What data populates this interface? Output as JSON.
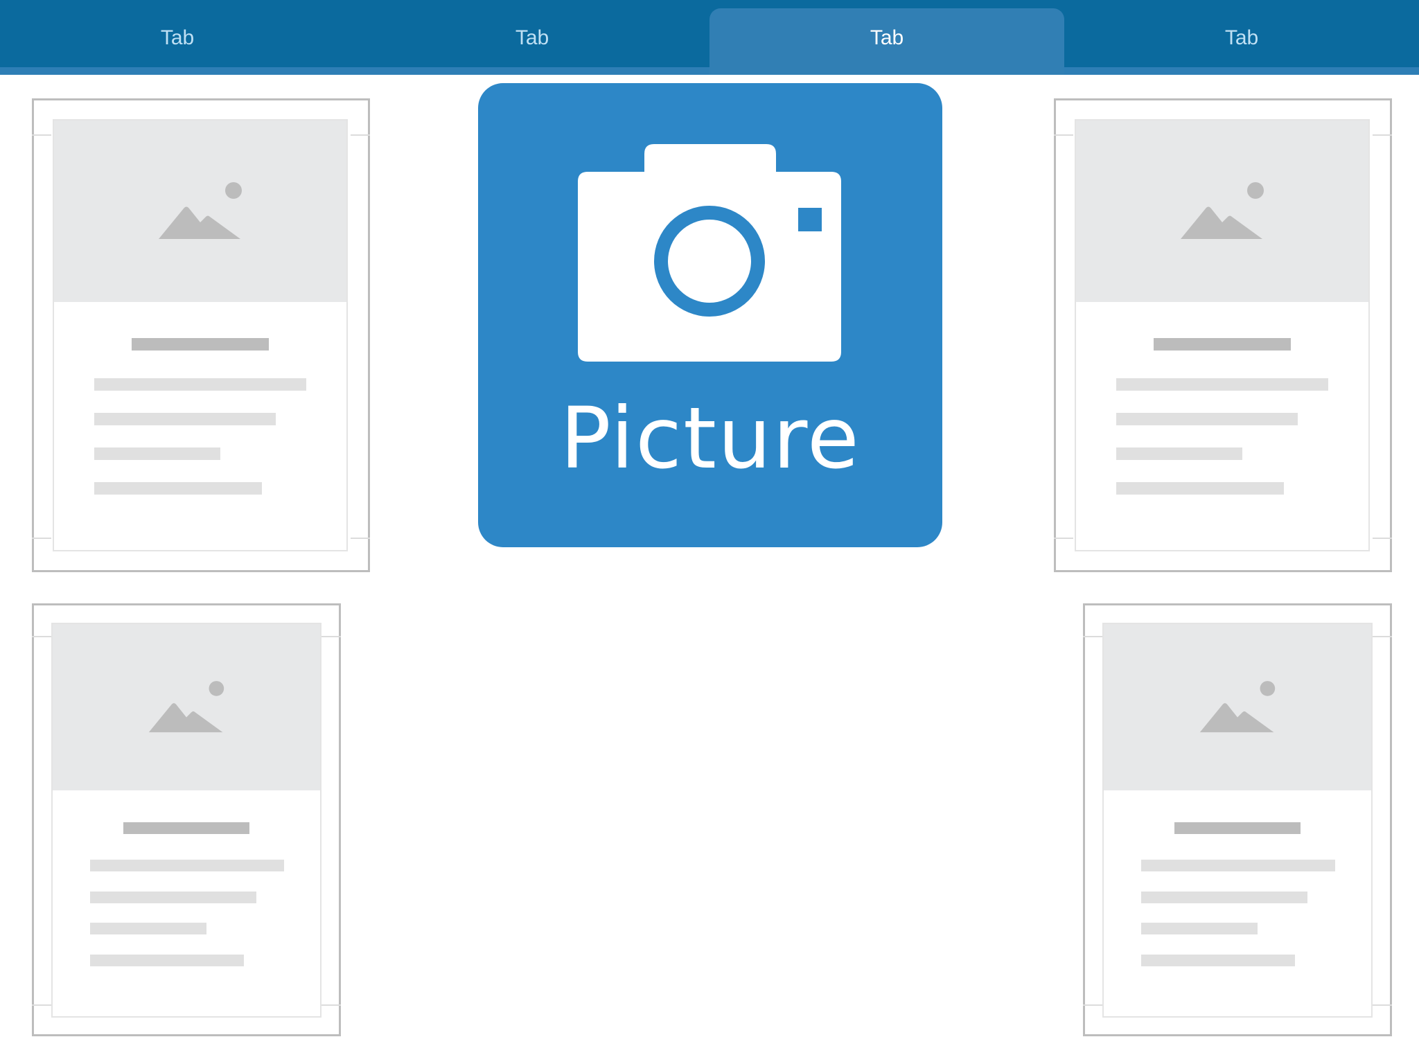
{
  "tabs": [
    {
      "label": "Tab",
      "active": false
    },
    {
      "label": "Tab",
      "active": false
    },
    {
      "label": "Tab",
      "active": true
    },
    {
      "label": "Tab",
      "active": false
    }
  ],
  "picture_tile": {
    "label": "Picture",
    "icon": "camera-icon",
    "color": "#2d87c7"
  },
  "cards": [
    {
      "name": "card-top-left",
      "icon": "image-placeholder-icon"
    },
    {
      "name": "card-top-right",
      "icon": "image-placeholder-icon"
    },
    {
      "name": "card-bottom-left",
      "icon": "image-placeholder-icon"
    },
    {
      "name": "card-bottom-right",
      "icon": "image-placeholder-icon"
    }
  ],
  "colors": {
    "tabbar": "#0b6a9e",
    "tab_active": "#317fb4",
    "placeholder_bg": "#e7e8e9",
    "placeholder_icon": "#bcbcbc"
  }
}
